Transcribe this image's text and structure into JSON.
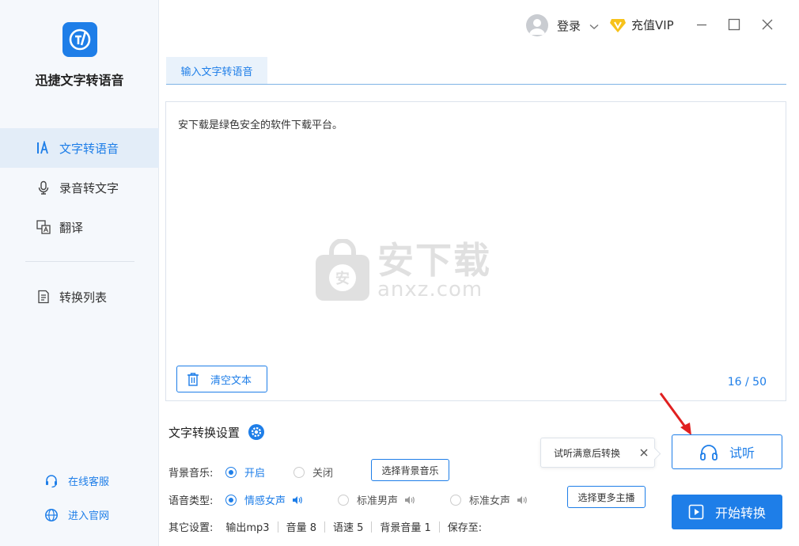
{
  "app": {
    "name": "迅捷文字转语音"
  },
  "sidebar": {
    "items": [
      {
        "label": "文字转语音",
        "icon": "text-to-speech-icon",
        "active": true
      },
      {
        "label": "录音转文字",
        "icon": "microphone-icon",
        "active": false
      },
      {
        "label": "翻译",
        "icon": "translate-icon",
        "active": false
      },
      {
        "label": "转换列表",
        "icon": "conversion-list-icon",
        "active": false
      }
    ],
    "footer": [
      {
        "label": "在线客服",
        "icon": "headset-support-icon"
      },
      {
        "label": "进入官网",
        "icon": "globe-icon"
      }
    ]
  },
  "topbar": {
    "login_label": "登录",
    "vip_label": "充值VIP"
  },
  "tab": {
    "label": "输入文字转语音"
  },
  "editor": {
    "text": "安下载是绿色安全的软件下载平台。",
    "clear_label": "清空文本",
    "counter": "16 / 50"
  },
  "watermark": {
    "cn": "安下载",
    "en": "anxz.com",
    "badge": "安"
  },
  "settings": {
    "title": "文字转换设置",
    "bgm": {
      "label": "背景音乐:",
      "on": "开启",
      "off": "关闭",
      "selected": "开启",
      "button": "选择背景音乐"
    },
    "voice": {
      "label": "语音类型:",
      "options": [
        "情感女声",
        "标准男声",
        "标准女声"
      ],
      "selected": "情感女声",
      "button": "选择更多主播"
    },
    "other": {
      "label": "其它设置:",
      "format": "输出mp3",
      "volume": "音量 8",
      "speed": "语速 5",
      "bg_volume": "背景音量 1",
      "save_to": "保存至:"
    }
  },
  "tooltip": {
    "text": "试听满意后转换"
  },
  "actions": {
    "listen_label": "试听",
    "start_label": "开始转换"
  },
  "colors": {
    "accent": "#1e7ee8",
    "sidebar_bg": "#f5f8fc",
    "active_bg": "#e3edf8",
    "arrow": "#e02020"
  }
}
